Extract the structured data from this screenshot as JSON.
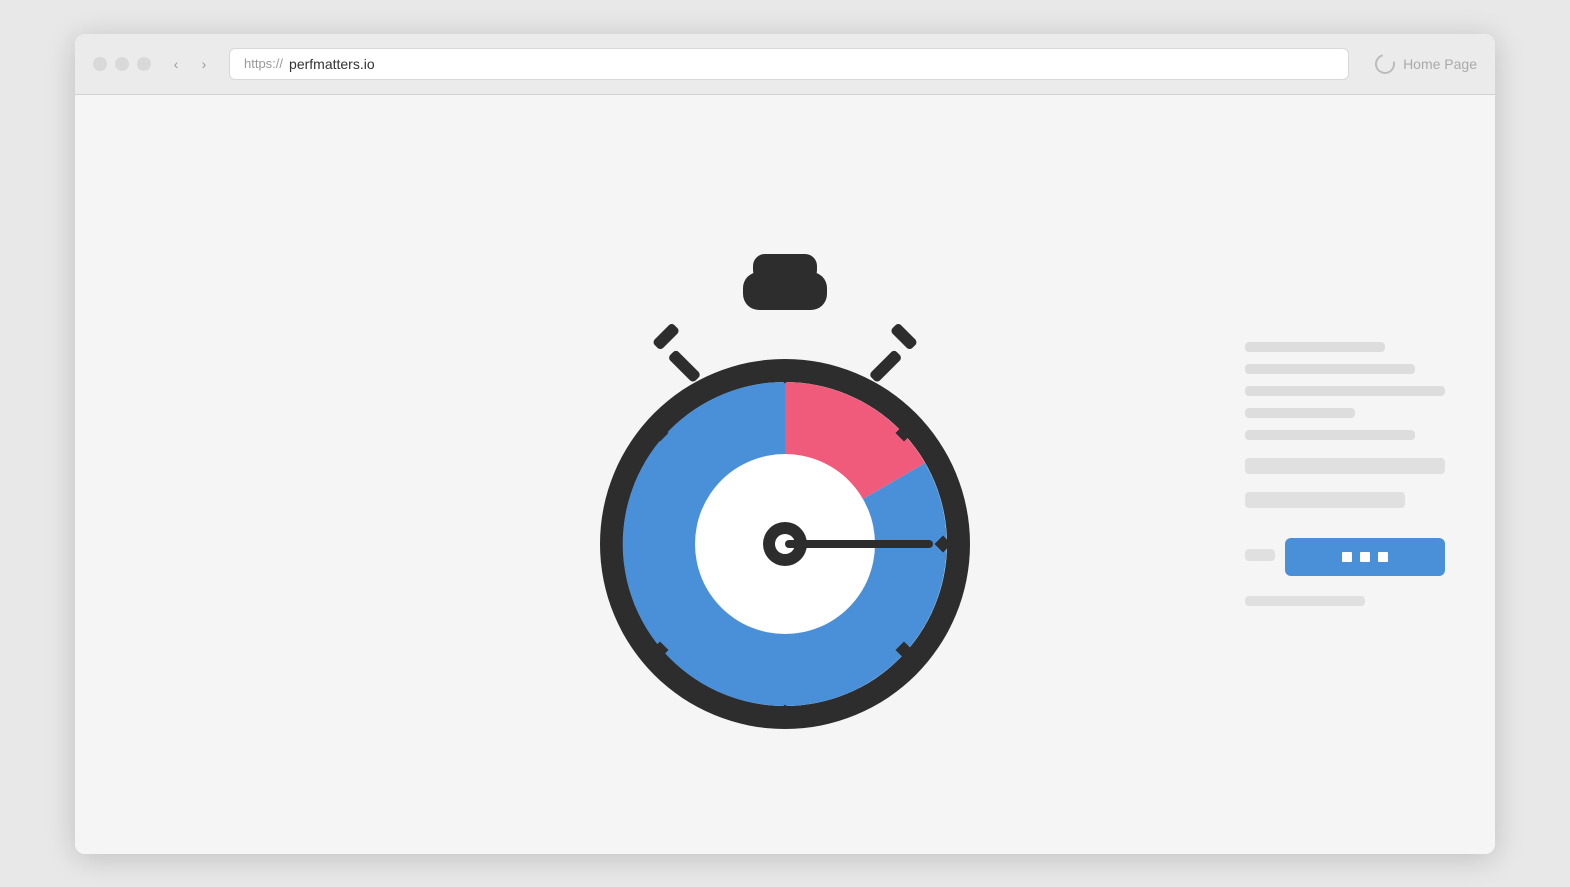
{
  "browser": {
    "url_protocol": "https://",
    "url_domain": "perfmatters.io",
    "home_page_label": "Home Page",
    "back_arrow": "‹",
    "forward_arrow": "›"
  },
  "right_panel": {
    "cta_dots": [
      "■",
      "■",
      "■"
    ]
  },
  "colors": {
    "blue": "#4a90d9",
    "pink": "#f05a7b",
    "dark": "#2d2d2d",
    "white": "#ffffff"
  }
}
